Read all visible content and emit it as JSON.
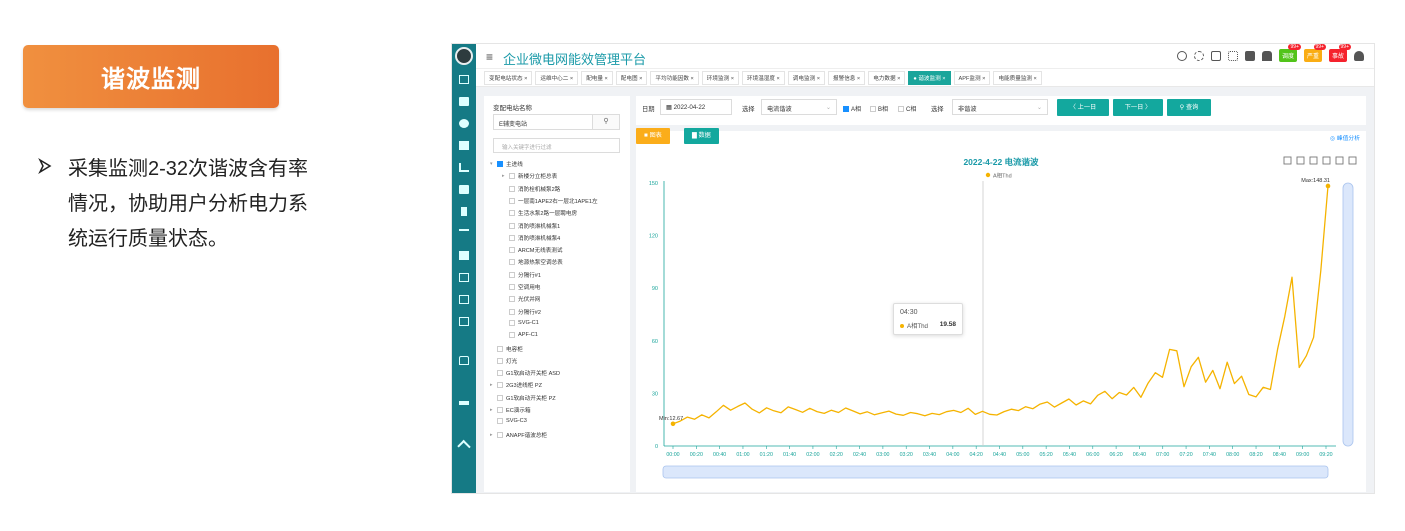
{
  "slide": {
    "title": "谐波监测",
    "bullet_lines": [
      "采集监测2-32次谐波含有率",
      "情况，协助用户分析电力系",
      "统运行质量状态。"
    ]
  },
  "app": {
    "title": "企业微电网能效管理平台",
    "badges": [
      {
        "label": "调度",
        "count": "99+",
        "color": "#52c41a"
      },
      {
        "label": "严重",
        "count": "99+",
        "color": "#faad14"
      },
      {
        "label": "事故",
        "count": "99+",
        "color": "#f5222d"
      }
    ],
    "tabs": [
      "变配电站状态",
      "运维中心二",
      "配电量",
      "配电图",
      "平均功能因数",
      "环境监测",
      "环境温湿度",
      "调电监测",
      "报警信息",
      "电力数据",
      "谐波监测",
      "APF监测",
      "电能质量监测"
    ],
    "active_tab": "谐波监测"
  },
  "left_panel": {
    "station_label": "变配电站名称",
    "station_value": "E辅变电站",
    "filter_placeholder": "输入关键字进行过滤",
    "tree": [
      {
        "label": "主进线",
        "checked": true,
        "caret": "open",
        "level": 0
      },
      {
        "label": "新楼分立柜总表",
        "checked": false,
        "caret": "closed",
        "level": 1
      },
      {
        "label": "消防栓机械泵2路",
        "checked": false,
        "caret": "",
        "level": 1
      },
      {
        "label": "一层南1APE2右一层北1APE1左",
        "checked": false,
        "caret": "",
        "level": 1
      },
      {
        "label": "生活水泵2路一层聘电房",
        "checked": false,
        "caret": "",
        "level": 1
      },
      {
        "label": "消防喷淋机械泵1",
        "checked": false,
        "caret": "",
        "level": 1
      },
      {
        "label": "消防喷淋机械泵4",
        "checked": false,
        "caret": "",
        "level": 1
      },
      {
        "label": "ARCM无线表测试",
        "checked": false,
        "caret": "",
        "level": 1
      },
      {
        "label": "地源热泵空调总表",
        "checked": false,
        "caret": "",
        "level": 1
      },
      {
        "label": "分隔行#1",
        "checked": false,
        "caret": "",
        "level": 1
      },
      {
        "label": "空调用电",
        "checked": false,
        "caret": "",
        "level": 1
      },
      {
        "label": "光伏并网",
        "checked": false,
        "caret": "",
        "level": 1
      },
      {
        "label": "分隔行#2",
        "checked": false,
        "caret": "",
        "level": 1
      },
      {
        "label": "SVG-C1",
        "checked": false,
        "caret": "",
        "level": 1
      },
      {
        "label": "APF-C1",
        "checked": false,
        "caret": "",
        "level": 1
      },
      {
        "label": "电容柜",
        "checked": false,
        "caret": "",
        "level": 0
      },
      {
        "label": "灯光",
        "checked": false,
        "caret": "",
        "level": 0
      },
      {
        "label": "G1软启动开关柜 ASD",
        "checked": false,
        "caret": "",
        "level": 0
      },
      {
        "label": "2G3进线柜 PZ",
        "checked": false,
        "caret": "closed",
        "level": 0
      },
      {
        "label": "G1软启动开关柜 PZ",
        "checked": false,
        "caret": "",
        "level": 0
      },
      {
        "label": "EC演示箱",
        "checked": false,
        "caret": "closed",
        "level": 0
      },
      {
        "label": "SVG-C3",
        "checked": false,
        "caret": "",
        "level": 0
      },
      {
        "label": "ANAPF谐波总柜",
        "checked": false,
        "caret": "closed",
        "level": 0
      }
    ]
  },
  "query": {
    "date_label": "日期",
    "date_value": "2022-04-22",
    "select_label": "选择",
    "select_value": "电流谐波",
    "phase_a": "A相",
    "phase_b": "B相",
    "phase_c": "C相",
    "select2_label": "选择",
    "select2_value": "非谐波",
    "prev_label": "〈 上一日",
    "next_label": "下一日 〉",
    "search_label": "查询",
    "chart_btn": "图表",
    "data_btn": "数据",
    "peak_label": "◎ 峰值分析"
  },
  "chart_data": {
    "type": "line",
    "title": "2022-4-22  电流谐波",
    "series": [
      {
        "name": "A相Thd",
        "color": "#f5b300",
        "values": [
          12.67,
          14.2,
          16.5,
          15.3,
          17.8,
          16.0,
          19.5,
          23.2,
          20.4,
          22.6,
          24.5,
          21.0,
          18.9,
          21.8,
          20.1,
          19.0,
          22.3,
          20.8,
          19.2,
          21.5,
          19.6,
          18.6,
          20.4,
          19.1,
          21.7,
          20.0,
          18.3,
          19.5,
          17.8,
          18.9,
          19.9,
          18.2,
          17.5,
          19.1,
          18.4,
          17.2,
          18.6,
          17.9,
          19.58,
          20.3,
          19.1,
          21.5,
          18.0,
          19.8,
          18.1,
          17.7,
          19.6,
          21.0,
          20.2,
          22.4,
          21.3,
          23.9,
          25.1,
          22.2,
          24.5,
          26.8,
          23.4,
          25.7,
          24.0,
          28.9,
          31.2,
          27.0,
          30.5,
          29.1,
          33.4,
          27.8,
          35.9,
          41.8,
          39.2,
          55.1,
          54.3,
          33.8,
          45.2,
          50.6,
          36.4,
          43.1,
          32.7,
          47.8,
          35.6,
          39.8,
          29.4,
          28.0,
          33.5,
          32.2,
          55.2,
          74.0,
          96.3,
          44.8,
          51.5,
          62.0,
          100.0,
          148.31
        ]
      }
    ],
    "x_ticks": [
      "00:00",
      "00:20",
      "00:40",
      "01:00",
      "01:20",
      "01:40",
      "02:00",
      "02:20",
      "02:40",
      "03:00",
      "03:20",
      "03:40",
      "04:00",
      "04:20",
      "04:40",
      "05:00",
      "05:20",
      "05:40",
      "06:00",
      "06:20",
      "06:40",
      "07:00",
      "07:20",
      "07:40",
      "08:00",
      "08:20",
      "08:40",
      "09:00",
      "09:20"
    ],
    "y_ticks": [
      "0",
      "30",
      "60",
      "90",
      "120",
      "150"
    ],
    "ylim": [
      0,
      160
    ],
    "min_label": "Min:12.67",
    "max_label": "Max:148.31",
    "tooltip": {
      "time": "04:30",
      "name": "A相Thd",
      "value": "19.58"
    },
    "legend_position": "top-center",
    "grid": false
  }
}
